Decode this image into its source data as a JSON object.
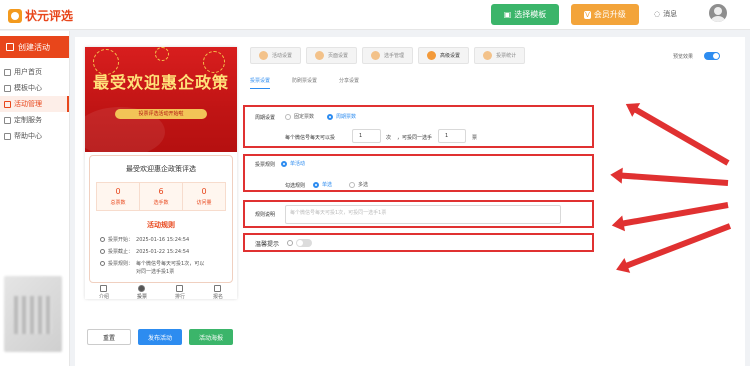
{
  "header": {
    "logo_text": "状元评选",
    "template_button": "选择模板",
    "upgrade_button": "会员升级",
    "message_label": "消息"
  },
  "sidebar": {
    "create_button": "创建活动",
    "items": [
      {
        "label": "用户首页",
        "active": false
      },
      {
        "label": "模板中心",
        "active": false
      },
      {
        "label": "活动管理",
        "active": true
      },
      {
        "label": "定制服务",
        "active": false
      },
      {
        "label": "帮助中心",
        "active": false
      }
    ]
  },
  "preview": {
    "poster_title": "最受欢迎惠企政策",
    "poster_subtitle": "投票评选活动开始啦",
    "card_title": "最受欢迎惠企政策评选",
    "stats": [
      {
        "value": "0",
        "label": "总票数"
      },
      {
        "value": "6",
        "label": "选手数"
      },
      {
        "value": "0",
        "label": "访问量"
      }
    ],
    "rules_heading": "活动规则",
    "start_label": "投票开始：",
    "start_value": "2025-01-16 15:24:54",
    "end_label": "投票截止：",
    "end_value": "2025-01-22 15:24:54",
    "rule_label": "投票规则：",
    "rule_value": "每个微信号每天可投1次，可以对同一选手投1票",
    "tabs": [
      "介绍",
      "投票",
      "排行",
      "报名"
    ],
    "active_tab": "投票"
  },
  "actions": {
    "reset": "重置",
    "publish": "发布活动",
    "poster": "活动海报"
  },
  "steps": [
    "活动设置",
    "页面设置",
    "选手管理",
    "高级设置",
    "投票统计"
  ],
  "active_step": "高级设置",
  "preview_toggle": {
    "label": "预览效果",
    "on": true
  },
  "subtabs": [
    "投票设置",
    "防刷票设置",
    "分享设置"
  ],
  "active_subtab": "投票设置",
  "vote_setting": {
    "label": "周期设置",
    "options": [
      "固定票数",
      "周期票数"
    ],
    "selected": "周期票数",
    "per_day_prefix": "每个微信号每天可以投",
    "per_day_value": "1",
    "per_day_unit": "次",
    "per_player_prefix": "，可投同一选手",
    "per_player_value": "1",
    "per_player_unit": "票"
  },
  "vote_rule": {
    "label": "投票规则",
    "option": "单活动",
    "select_label": "勾选规则",
    "select_options": [
      "单选",
      "多选"
    ],
    "selected": "单选"
  },
  "rule_desc": {
    "label": "规则说明",
    "placeholder": "每个微信号每天可投1次，可投同一选手1票"
  },
  "reminder": {
    "label": "温馨提示",
    "on": false
  }
}
